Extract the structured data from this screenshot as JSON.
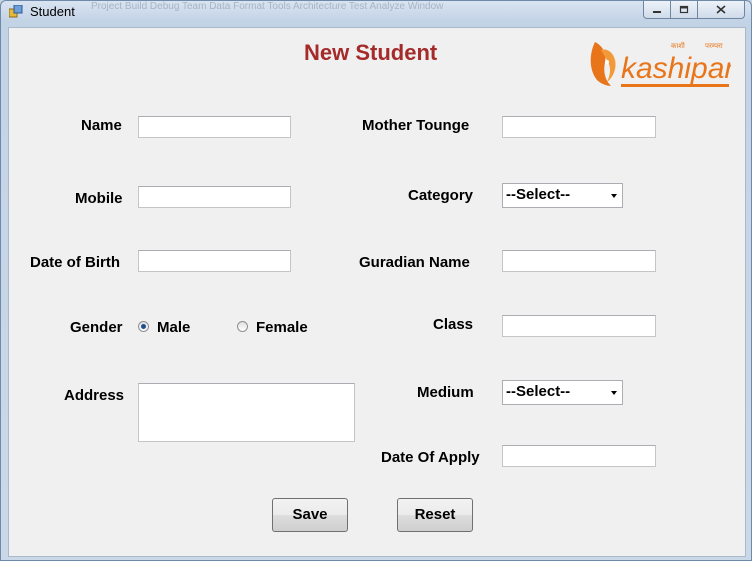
{
  "window": {
    "title": "Student",
    "background_menu": "Project   Build   Debug   Team   Data   Format   Tools   Architecture   Test   Analyze   Window"
  },
  "form": {
    "heading": "New Student",
    "logo_text": "kashipara",
    "logo_small_left": "काशी",
    "logo_small_right": "परम्परा",
    "left": {
      "name_label": "Name",
      "mobile_label": "Mobile",
      "dob_label": "Date of Birth",
      "gender_label": "Gender",
      "male_label": "Male",
      "female_label": "Female",
      "address_label": "Address"
    },
    "right": {
      "mother_tongue_label": "Mother Tounge",
      "category_label": "Category",
      "category_value": "--Select--",
      "guardian_label": "Guradian Name",
      "class_label": "Class",
      "medium_label": "Medium",
      "medium_value": "--Select--",
      "date_apply_label": "Date Of Apply"
    },
    "save_label": "Save",
    "reset_label": "Reset"
  },
  "colors": {
    "heading": "#a52a2a",
    "logo": "#e8751a"
  }
}
